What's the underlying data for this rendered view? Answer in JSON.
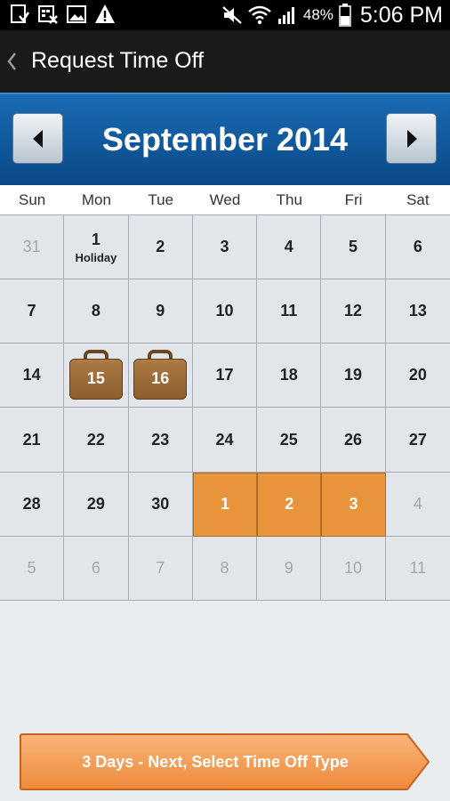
{
  "status_bar": {
    "battery_percent": "48%",
    "time": "5:06 PM",
    "left_icons": [
      "download-done-icon",
      "calendar-x-icon",
      "image-icon",
      "warning-icon"
    ],
    "right_icons": [
      "mute-icon",
      "wifi-icon",
      "signal-icon",
      "battery-icon"
    ]
  },
  "header": {
    "title": "Request Time Off"
  },
  "calendar": {
    "month_label": "September 2014",
    "weekdays": [
      "Sun",
      "Mon",
      "Tue",
      "Wed",
      "Thu",
      "Fri",
      "Sat"
    ],
    "weeks": [
      [
        {
          "day": "31",
          "state": "other"
        },
        {
          "day": "1",
          "state": "holiday",
          "note": "Holiday"
        },
        {
          "day": "2"
        },
        {
          "day": "3"
        },
        {
          "day": "4"
        },
        {
          "day": "5"
        },
        {
          "day": "6"
        }
      ],
      [
        {
          "day": "7"
        },
        {
          "day": "8"
        },
        {
          "day": "9"
        },
        {
          "day": "10"
        },
        {
          "day": "11"
        },
        {
          "day": "12"
        },
        {
          "day": "13"
        }
      ],
      [
        {
          "day": "14"
        },
        {
          "day": "15",
          "state": "timeoff"
        },
        {
          "day": "16",
          "state": "timeoff"
        },
        {
          "day": "17"
        },
        {
          "day": "18"
        },
        {
          "day": "19"
        },
        {
          "day": "20"
        }
      ],
      [
        {
          "day": "21"
        },
        {
          "day": "22"
        },
        {
          "day": "23"
        },
        {
          "day": "24"
        },
        {
          "day": "25"
        },
        {
          "day": "26"
        },
        {
          "day": "27"
        }
      ],
      [
        {
          "day": "28"
        },
        {
          "day": "29"
        },
        {
          "day": "30"
        },
        {
          "day": "1",
          "state": "selected"
        },
        {
          "day": "2",
          "state": "selected"
        },
        {
          "day": "3",
          "state": "selected"
        },
        {
          "day": "4",
          "state": "other"
        }
      ],
      [
        {
          "day": "5",
          "state": "other"
        },
        {
          "day": "6",
          "state": "other"
        },
        {
          "day": "7",
          "state": "other"
        },
        {
          "day": "8",
          "state": "other"
        },
        {
          "day": "9",
          "state": "other"
        },
        {
          "day": "10",
          "state": "other"
        },
        {
          "day": "11",
          "state": "other"
        }
      ]
    ]
  },
  "footer": {
    "button_label": "3 Days - Next, Select Time Off Type"
  },
  "colors": {
    "selected": "#e8943a",
    "header_blue": "#10589b",
    "cta": "#f29a4a"
  }
}
